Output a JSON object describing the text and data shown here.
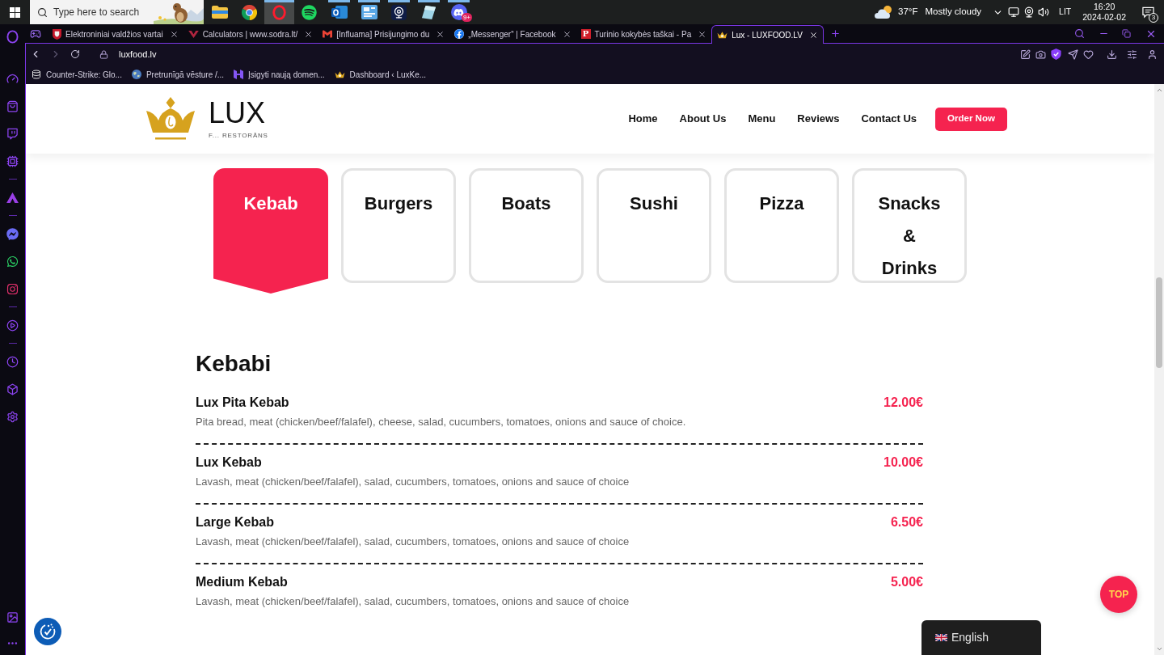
{
  "taskbar": {
    "search": {
      "placeholder": "Type here to search"
    },
    "apps": [
      {
        "kind": "explorer",
        "selected": false,
        "running": false
      },
      {
        "kind": "chrome",
        "selected": false,
        "running": false
      },
      {
        "kind": "opera",
        "selected": true,
        "running": true
      },
      {
        "kind": "spotify",
        "selected": false,
        "running": false
      },
      {
        "kind": "outlook",
        "selected": false,
        "running": true
      },
      {
        "kind": "news",
        "selected": false,
        "running": true
      },
      {
        "kind": "webcam",
        "selected": false,
        "running": true
      },
      {
        "kind": "notes",
        "selected": false,
        "running": true
      },
      {
        "kind": "discord",
        "selected": false,
        "running": true,
        "badge": "9+"
      }
    ],
    "weather": {
      "temperature": "37°F",
      "condition": "Mostly cloudy"
    },
    "input_language": "LIT",
    "time": "16:20",
    "date": "2024-02-02",
    "notification_count": "3"
  },
  "browser": {
    "tabs": [
      {
        "title": "Elektroniniai valdžios vartai",
        "selected": false
      },
      {
        "title": "Calculators | www.sodra.lt/",
        "selected": false
      },
      {
        "title": "[Influama] Prisijungimo du",
        "selected": false
      },
      {
        "title": "„Messenger“ | Facebook",
        "selected": false
      },
      {
        "title": "Turinio kokybės taškai - Pa",
        "favicon_text": "P",
        "selected": false
      },
      {
        "title": "Lux - LUXFOOD.LV",
        "selected": true
      }
    ],
    "address": "luxfood.lv",
    "bookmarks": [
      {
        "title": "Counter-Strike: Glo..."
      },
      {
        "title": "Pretrunīgā vēsture /..."
      },
      {
        "title": "Įsigyti naują domen..."
      },
      {
        "title": "Dashboard ‹ LuxKe..."
      }
    ]
  },
  "site": {
    "logo": {
      "wordmark": "LUX",
      "tagline": "F... RESTORĀNS"
    },
    "nav": [
      "Home",
      "About Us",
      "Menu",
      "Reviews",
      "Contact Us"
    ],
    "order_button": "Order Now",
    "categories": [
      {
        "label": "Kebab",
        "selected": true
      },
      {
        "label": "Burgers",
        "selected": false
      },
      {
        "label": "Boats",
        "selected": false
      },
      {
        "label": "Sushi",
        "selected": false
      },
      {
        "label": "Pizza",
        "selected": false
      },
      {
        "label": "Snacks & Drinks",
        "selected": false
      }
    ],
    "section_title": "Kebabi",
    "dishes": [
      {
        "name": "Lux Pita Kebab",
        "price": "12.00€",
        "description": "Pita bread, meat (chicken/beef/falafel), cheese, salad, cucumbers, tomatoes, onions and sauce of choice."
      },
      {
        "name": "Lux Kebab",
        "price": "10.00€",
        "description": "Lavash, meat (chicken/beef/falafel), salad, cucumbers, tomatoes, onions and sauce of choice"
      },
      {
        "name": "Large Kebab",
        "price": "6.50€",
        "description": "Lavash, meat (chicken/beef/falafel), salad, cucumbers, tomatoes, onions and sauce of choice"
      },
      {
        "name": "Medium Kebab",
        "price": "5.00€",
        "description": "Lavash, meat (chicken/beef/falafel), salad, cucumbers, tomatoes, onions and sauce of choice"
      }
    ],
    "top_button": "TOP",
    "language": "English"
  }
}
